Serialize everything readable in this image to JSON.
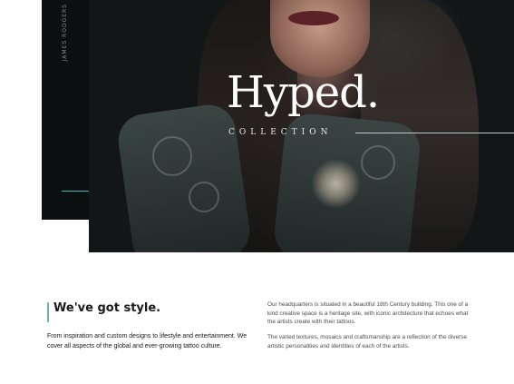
{
  "side_caption": "JAMES RODGERS",
  "hero": {
    "title": "Hyped.",
    "subtitle": "COLLECTION"
  },
  "section": {
    "heading": "We've got style.",
    "intro": "From inspiration and custom designs to lifestyle and entertainment. We cover all aspects of the global and ever-growing tattoo culture.",
    "paragraph_1": "Our headquarters is situated in a beautiful 18th Century building. This one of a kind creative space is a heritage site, with iconic architecture that echoes what the artists create with their tattoos.",
    "paragraph_2": "The varied textures, mosaics and craftsmanship are a reflection of the diverse artistic personalities and identities of each of the artists."
  },
  "colors": {
    "accent": "#6fb3ad",
    "dark_panel": "#0b0f10"
  }
}
